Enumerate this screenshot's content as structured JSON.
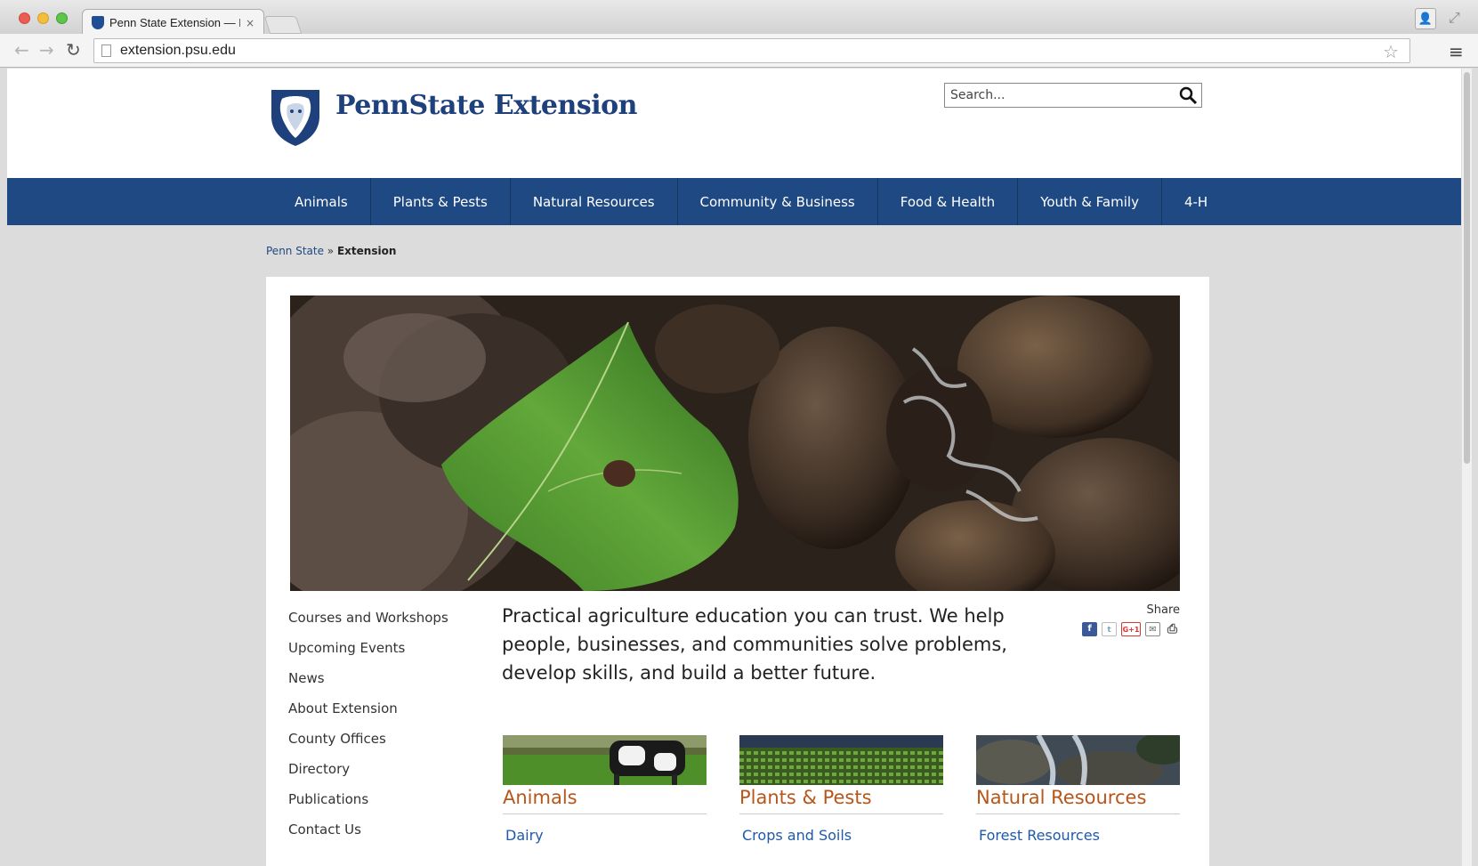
{
  "browser": {
    "tab_title": "Penn State Extension — Pe",
    "tab_close": "×",
    "url": "extension.psu.edu",
    "back_icon": "←",
    "forward_icon": "→",
    "reload_icon": "↻",
    "star_icon": "☆",
    "menu_icon": "≡",
    "fullscreen_icon": "⤢",
    "profile_icon": "👤"
  },
  "header": {
    "logo_text": "PennState Extension",
    "search_placeholder": "Search..."
  },
  "nav": {
    "items": [
      "Animals",
      "Plants & Pests",
      "Natural Resources",
      "Community & Business",
      "Food & Health",
      "Youth & Family",
      "4-H"
    ]
  },
  "breadcrumb": {
    "root": "Penn State",
    "sep": " » ",
    "current": "Extension"
  },
  "sidebar": {
    "links": [
      "Courses and Workshops",
      "Upcoming Events",
      "News",
      "About Extension",
      "County Offices",
      "Directory",
      "Publications",
      "Contact Us"
    ]
  },
  "intro": {
    "text": "Practical agriculture education you can trust. We help people, businesses, and communities solve problems, develop skills, and build a better future."
  },
  "share": {
    "label": "Share",
    "facebook": "f",
    "twitter": "t",
    "googleplus": "G+1",
    "email": "✉",
    "print": "⎙"
  },
  "cards": [
    {
      "title": "Animals",
      "link": "Dairy"
    },
    {
      "title": "Plants & Pests",
      "link": "Crops and Soils"
    },
    {
      "title": "Natural Resources",
      "link": "Forest Resources"
    }
  ],
  "colors": {
    "brand_navy": "#1e4983",
    "card_title_orange": "#b8561a",
    "link_blue": "#1e5aa8"
  }
}
